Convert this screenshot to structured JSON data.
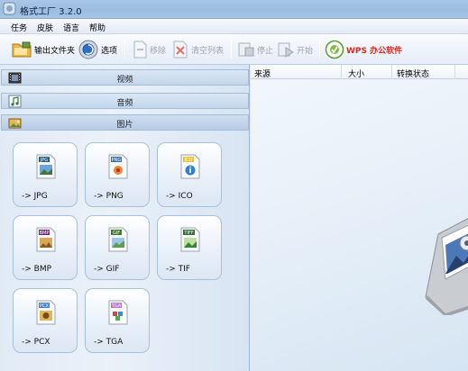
{
  "window": {
    "title": "格式工厂 3.2.0"
  },
  "menu": {
    "items": [
      "任务",
      "皮肤",
      "语言",
      "帮助"
    ]
  },
  "toolbar": {
    "output_folder": "输出文件夹",
    "options": "选项",
    "remove": "移除",
    "clear_list": "清空列表",
    "stop": "停止",
    "start": "开始",
    "wps": "WPS 办公软件"
  },
  "categories": {
    "video": "视频",
    "audio": "音频",
    "image": "图片"
  },
  "formats": [
    {
      "badge": "JPG",
      "label": "-> JPG",
      "icon": "jpg-file-icon"
    },
    {
      "badge": "PNG",
      "label": "-> PNG",
      "icon": "png-file-icon"
    },
    {
      "badge": "ICO",
      "label": "-> ICO",
      "icon": "ico-file-icon"
    },
    {
      "badge": "BMP",
      "label": "-> BMP",
      "icon": "bmp-file-icon"
    },
    {
      "badge": "GIF",
      "label": "-> GIF",
      "icon": "gif-file-icon"
    },
    {
      "badge": "TIFF",
      "label": "-> TIF",
      "icon": "tiff-file-icon"
    },
    {
      "badge": "PCX",
      "label": "-> PCX",
      "icon": "pcx-file-icon"
    },
    {
      "badge": "TGA",
      "label": "-> TGA",
      "icon": "tga-file-icon"
    }
  ],
  "task_list": {
    "columns": [
      "来源",
      "大小",
      "转换状态"
    ]
  },
  "colors": {
    "wps_red": "#e0261f",
    "badge_jpg": "#2c5f86",
    "badge_png": "#3d6fa8",
    "badge_ico": "#f1c232",
    "badge_bmp": "#6f2a80",
    "badge_gif": "#3f7a2c",
    "badge_tiff": "#2f6f3a",
    "badge_pcx": "#4a7fc2",
    "badge_tga": "#b27ac8"
  }
}
